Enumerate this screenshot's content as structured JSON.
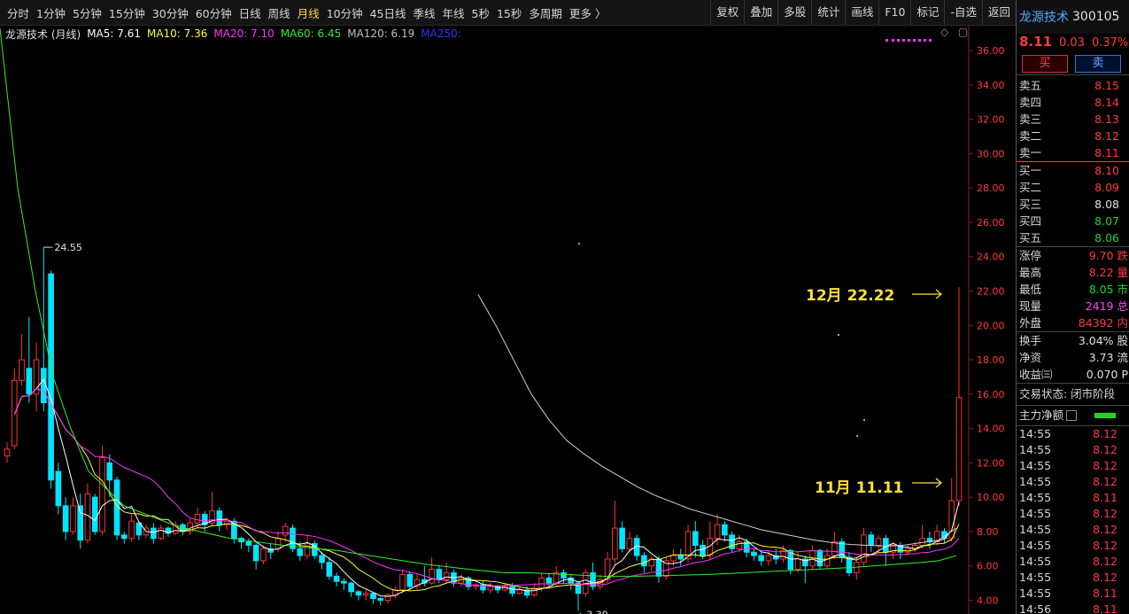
{
  "toolbar": {
    "left": [
      "分时",
      "1分钟",
      "5分钟",
      "15分钟",
      "30分钟",
      "60分钟",
      "日线",
      "周线",
      "月线",
      "10分钟",
      "45日线",
      "季线",
      "年线",
      "5秒",
      "15秒",
      "多周期",
      "更多 〉"
    ],
    "active": "月线",
    "right": [
      "复权",
      "叠加",
      "多股",
      "统计",
      "画线",
      "F10",
      "标记",
      "-自选",
      "返回"
    ]
  },
  "legend": {
    "title": "龙源技术 (月线)",
    "items": [
      {
        "text": "MA5: 7.61",
        "color": "#ffffff"
      },
      {
        "text": "MA10: 7.36",
        "color": "#ffff33"
      },
      {
        "text": "MA20: 7.10",
        "color": "#ff33ff"
      },
      {
        "text": "MA60: 6.45",
        "color": "#33ee33"
      },
      {
        "text": "MA120: 6.19",
        "color": "#c0c0c0"
      },
      {
        "text": "MA250:",
        "color": "#3333ff"
      }
    ],
    "diamond_icon": "◇",
    "window_icon": "▢"
  },
  "annotations": {
    "dec": "12月 22.22",
    "nov": "11月 11.11",
    "high_label": "24.55",
    "low_label": "3.39"
  },
  "chart_data": {
    "type": "candlestick",
    "ylim": [
      3.2,
      37.5
    ],
    "y_ticks": [
      "4.00",
      "6.00",
      "8.00",
      "10.00",
      "12.00",
      "14.00",
      "16.00",
      "18.00",
      "20.00",
      "22.00",
      "24.00",
      "26.00",
      "28.00",
      "30.00",
      "32.00",
      "34.00",
      "36.00"
    ],
    "colors": {
      "up": "#ff3333",
      "down": "#00e5ff"
    },
    "candles": [
      [
        12.4,
        12.8,
        12.0,
        13.2
      ],
      [
        13.0,
        16.8,
        12.8,
        17.5
      ],
      [
        16.8,
        18.0,
        16.5,
        19.5
      ],
      [
        17.5,
        16.0,
        15.5,
        20.5
      ],
      [
        16.0,
        18.0,
        15.0,
        19.0
      ],
      [
        17.5,
        15.5,
        15.0,
        24.55
      ],
      [
        23.0,
        11.0,
        10.5,
        23.2
      ],
      [
        11.5,
        9.5,
        9.0,
        12.0
      ],
      [
        9.5,
        8.0,
        7.5,
        10.0
      ],
      [
        8.0,
        9.5,
        7.8,
        10.0
      ],
      [
        9.5,
        7.5,
        7.0,
        10.2
      ],
      [
        7.5,
        10.2,
        7.3,
        10.8
      ],
      [
        10.0,
        8.0,
        7.8,
        10.2
      ],
      [
        8.0,
        12.3,
        7.8,
        13.0
      ],
      [
        12.0,
        11.0,
        10.0,
        12.5
      ],
      [
        11.0,
        7.8,
        7.5,
        11.2
      ],
      [
        7.8,
        7.6,
        7.3,
        8.0
      ],
      [
        7.6,
        8.6,
        7.4,
        9.0
      ],
      [
        8.5,
        7.8,
        7.5,
        8.6
      ],
      [
        7.8,
        8.2,
        7.6,
        8.4
      ],
      [
        8.2,
        7.6,
        7.3,
        8.5
      ],
      [
        7.6,
        8.2,
        7.5,
        8.4
      ],
      [
        8.2,
        7.9,
        7.7,
        8.3
      ],
      [
        7.9,
        8.4,
        7.8,
        8.6
      ],
      [
        8.4,
        8.0,
        7.8,
        8.5
      ],
      [
        8.0,
        8.5,
        7.8,
        8.8
      ],
      [
        8.5,
        9.0,
        8.2,
        9.4
      ],
      [
        9.0,
        8.4,
        8.0,
        9.2
      ],
      [
        8.5,
        9.2,
        8.3,
        10.3
      ],
      [
        9.2,
        8.4,
        8.0,
        9.4
      ],
      [
        8.4,
        8.6,
        8.1,
        8.8
      ],
      [
        8.6,
        7.6,
        7.3,
        8.8
      ],
      [
        7.6,
        7.4,
        7.0,
        7.7
      ],
      [
        7.4,
        7.2,
        6.8,
        7.6
      ],
      [
        7.2,
        6.3,
        5.8,
        7.4
      ],
      [
        6.3,
        7.0,
        6.1,
        7.2
      ],
      [
        7.0,
        6.8,
        6.4,
        7.3
      ],
      [
        7.0,
        7.6,
        6.8,
        8.0
      ],
      [
        7.8,
        8.3,
        7.4,
        8.5
      ],
      [
        8.2,
        7.0,
        6.8,
        8.4
      ],
      [
        7.0,
        6.6,
        6.3,
        7.4
      ],
      [
        6.6,
        7.3,
        6.4,
        7.8
      ],
      [
        7.3,
        6.6,
        6.4,
        7.5
      ],
      [
        6.6,
        6.2,
        5.8,
        6.8
      ],
      [
        6.2,
        5.4,
        5.2,
        6.5
      ],
      [
        5.4,
        5.1,
        4.8,
        5.6
      ],
      [
        5.1,
        5.0,
        4.6,
        5.3
      ],
      [
        5.0,
        4.5,
        4.2,
        5.1
      ],
      [
        4.5,
        4.3,
        4.0,
        4.6
      ],
      [
        4.3,
        4.4,
        4.0,
        4.6
      ],
      [
        4.4,
        4.1,
        3.8,
        4.5
      ],
      [
        4.1,
        4.0,
        3.7,
        4.2
      ],
      [
        4.0,
        4.3,
        3.8,
        4.4
      ],
      [
        4.3,
        4.6,
        4.1,
        4.8
      ],
      [
        4.6,
        5.5,
        4.4,
        5.8
      ],
      [
        5.5,
        4.8,
        4.6,
        5.7
      ],
      [
        4.8,
        5.2,
        4.6,
        5.5
      ],
      [
        5.2,
        5.0,
        4.8,
        6.0
      ],
      [
        5.0,
        5.8,
        4.9,
        6.5
      ],
      [
        5.8,
        5.2,
        5.0,
        6.0
      ],
      [
        5.2,
        5.6,
        5.0,
        6.2
      ],
      [
        5.6,
        5.0,
        4.8,
        5.8
      ],
      [
        5.0,
        5.3,
        4.8,
        5.5
      ],
      [
        5.3,
        4.8,
        4.6,
        5.4
      ],
      [
        4.8,
        4.9,
        4.6,
        5.0
      ],
      [
        4.9,
        4.6,
        4.4,
        5.1
      ],
      [
        4.6,
        4.8,
        4.4,
        5.0
      ],
      [
        4.8,
        4.6,
        4.4,
        4.9
      ],
      [
        4.6,
        4.8,
        4.5,
        5.0
      ],
      [
        4.8,
        4.4,
        4.2,
        5.0
      ],
      [
        4.4,
        4.6,
        4.3,
        4.8
      ],
      [
        4.6,
        4.3,
        4.1,
        4.8
      ],
      [
        4.3,
        4.7,
        4.2,
        5.0
      ],
      [
        4.7,
        5.3,
        4.5,
        5.6
      ],
      [
        5.3,
        5.0,
        4.8,
        5.6
      ],
      [
        5.0,
        5.6,
        4.8,
        6.0
      ],
      [
        5.6,
        5.3,
        5.0,
        5.8
      ],
      [
        5.3,
        5.0,
        4.6,
        5.5
      ],
      [
        5.0,
        4.4,
        3.39,
        5.1
      ],
      [
        4.4,
        5.6,
        4.2,
        5.8
      ],
      [
        5.6,
        4.8,
        4.6,
        6.2
      ],
      [
        4.8,
        5.2,
        4.6,
        5.5
      ],
      [
        5.2,
        6.4,
        5.0,
        6.8
      ],
      [
        6.4,
        8.2,
        6.0,
        9.8
      ],
      [
        8.2,
        7.0,
        6.8,
        8.6
      ],
      [
        7.0,
        7.6,
        6.8,
        8.0
      ],
      [
        7.6,
        6.6,
        6.3,
        7.8
      ],
      [
        6.6,
        6.0,
        5.6,
        6.8
      ],
      [
        6.0,
        6.4,
        5.7,
        6.6
      ],
      [
        6.4,
        5.4,
        5.0,
        6.6
      ],
      [
        5.4,
        6.3,
        5.2,
        6.5
      ],
      [
        6.3,
        6.6,
        6.0,
        7.0
      ],
      [
        6.6,
        6.4,
        6.0,
        7.0
      ],
      [
        6.4,
        8.0,
        6.2,
        8.4
      ],
      [
        8.0,
        7.2,
        6.5,
        8.6
      ],
      [
        7.2,
        6.6,
        6.4,
        7.5
      ],
      [
        6.6,
        7.6,
        6.4,
        8.6
      ],
      [
        7.6,
        8.4,
        7.2,
        9.0
      ],
      [
        8.4,
        7.8,
        7.4,
        8.6
      ],
      [
        7.8,
        7.0,
        6.8,
        8.0
      ],
      [
        7.0,
        7.4,
        6.8,
        7.8
      ],
      [
        7.4,
        6.8,
        6.5,
        7.6
      ],
      [
        6.8,
        6.6,
        6.3,
        7.0
      ],
      [
        6.6,
        6.3,
        6.0,
        6.8
      ],
      [
        6.3,
        6.6,
        6.0,
        6.9
      ],
      [
        6.6,
        6.4,
        6.1,
        7.0
      ],
      [
        6.4,
        6.9,
        6.2,
        7.2
      ],
      [
        6.9,
        5.8,
        5.5,
        7.0
      ],
      [
        5.8,
        6.4,
        5.6,
        6.8
      ],
      [
        6.4,
        6.0,
        5.0,
        6.6
      ],
      [
        6.0,
        6.9,
        5.8,
        7.2
      ],
      [
        6.9,
        6.0,
        5.8,
        7.0
      ],
      [
        6.0,
        6.6,
        5.8,
        7.0
      ],
      [
        6.6,
        7.4,
        6.4,
        8.0
      ],
      [
        7.4,
        6.5,
        6.2,
        7.6
      ],
      [
        6.5,
        5.6,
        5.4,
        6.8
      ],
      [
        5.6,
        6.2,
        5.2,
        6.5
      ],
      [
        6.2,
        7.8,
        6.0,
        8.2
      ],
      [
        7.8,
        7.2,
        6.8,
        8.0
      ],
      [
        7.2,
        7.6,
        6.8,
        7.8
      ],
      [
        7.6,
        6.8,
        6.0,
        7.8
      ],
      [
        6.8,
        7.2,
        6.4,
        7.4
      ],
      [
        7.2,
        6.8,
        6.4,
        7.4
      ],
      [
        6.8,
        7.0,
        6.6,
        7.2
      ],
      [
        7.0,
        7.2,
        6.8,
        7.4
      ],
      [
        7.2,
        7.6,
        7.0,
        8.4
      ],
      [
        7.6,
        7.4,
        7.0,
        8.0
      ],
      [
        7.4,
        8.0,
        7.2,
        8.4
      ],
      [
        8.0,
        7.6,
        7.3,
        8.2
      ],
      [
        7.6,
        9.8,
        7.4,
        11.11
      ],
      [
        9.8,
        15.8,
        9.5,
        22.22
      ]
    ],
    "ma": [
      {
        "name": "MA5",
        "color": "#ffffff",
        "points": []
      },
      {
        "name": "MA10",
        "color": "#ffff33",
        "points": []
      },
      {
        "name": "MA20",
        "color": "#ff33ff",
        "points": []
      },
      {
        "name": "MA60",
        "color": "#33ee33",
        "points": [
          [
            0,
            37.3
          ],
          [
            20,
            28
          ],
          [
            40,
            22
          ],
          [
            60,
            17
          ],
          [
            80,
            14
          ],
          [
            100,
            11.5
          ],
          [
            140,
            9.5
          ],
          [
            200,
            8.3
          ],
          [
            260,
            7.6
          ],
          [
            320,
            7.2
          ],
          [
            380,
            6.9
          ],
          [
            430,
            6.5
          ],
          [
            480,
            6.1
          ],
          [
            530,
            5.8
          ],
          [
            570,
            5.6
          ],
          [
            600,
            5.6
          ],
          [
            640,
            5.5
          ],
          [
            680,
            5.4
          ],
          [
            720,
            5.4
          ],
          [
            760,
            5.45
          ],
          [
            800,
            5.5
          ],
          [
            840,
            5.6
          ],
          [
            880,
            5.7
          ],
          [
            920,
            5.8
          ],
          [
            960,
            5.9
          ],
          [
            1000,
            6.05
          ],
          [
            1040,
            6.2
          ],
          [
            1060,
            6.3
          ],
          [
            1080,
            6.6
          ]
        ]
      },
      {
        "name": "MA120",
        "color": "#d0d0d0",
        "points": [
          [
            540,
            21.8
          ],
          [
            560,
            20
          ],
          [
            580,
            18
          ],
          [
            600,
            16
          ],
          [
            620,
            14.5
          ],
          [
            640,
            13.3
          ],
          [
            660,
            12.5
          ],
          [
            680,
            11.8
          ],
          [
            700,
            11.2
          ],
          [
            720,
            10.6
          ],
          [
            740,
            10.1
          ],
          [
            760,
            9.7
          ],
          [
            780,
            9.3
          ],
          [
            800,
            9.0
          ],
          [
            820,
            8.7
          ],
          [
            840,
            8.4
          ],
          [
            860,
            8.1
          ],
          [
            880,
            7.9
          ],
          [
            900,
            7.7
          ],
          [
            920,
            7.5
          ],
          [
            940,
            7.35
          ],
          [
            960,
            7.25
          ],
          [
            980,
            7.2
          ],
          [
            1000,
            7.15
          ],
          [
            1020,
            7.2
          ],
          [
            1040,
            7.35
          ],
          [
            1060,
            7.5
          ],
          [
            1080,
            8.2
          ]
        ]
      }
    ]
  },
  "panel": {
    "name": "龙源技术",
    "code": "300105",
    "price": "8.11",
    "change": "0.03",
    "pct": "0.37%",
    "buy_btn": "买",
    "sell_btn": "卖",
    "asks": [
      {
        "label": "卖五",
        "price": "8.15",
        "cls": "red"
      },
      {
        "label": "卖四",
        "price": "8.14",
        "cls": "red"
      },
      {
        "label": "卖三",
        "price": "8.13",
        "cls": "red"
      },
      {
        "label": "卖二",
        "price": "8.12",
        "cls": "red"
      },
      {
        "label": "卖一",
        "price": "8.11",
        "cls": "red"
      }
    ],
    "bids": [
      {
        "label": "买一",
        "price": "8.10",
        "cls": "red"
      },
      {
        "label": "买二",
        "price": "8.09",
        "cls": "red"
      },
      {
        "label": "买三",
        "price": "8.08",
        "cls": "white"
      },
      {
        "label": "买四",
        "price": "8.07",
        "cls": "green"
      },
      {
        "label": "买五",
        "price": "8.06",
        "cls": "green"
      }
    ],
    "stats1": [
      {
        "label": "涨停",
        "value": "9.70",
        "cls": "red",
        "extra": "跌"
      },
      {
        "label": "最高",
        "value": "8.22",
        "cls": "red",
        "extra": "量"
      },
      {
        "label": "最低",
        "value": "8.05",
        "cls": "green",
        "extra": "市"
      },
      {
        "label": "现量",
        "value": "2419",
        "cls": "mag",
        "extra": "总"
      },
      {
        "label": "外盘",
        "value": "84392",
        "cls": "red",
        "extra": "内"
      }
    ],
    "stats2": [
      {
        "label": "换手",
        "value": "3.04%",
        "cls": "white",
        "extra": "股"
      },
      {
        "label": "净资",
        "value": "3.73",
        "cls": "white",
        "extra": "流"
      },
      {
        "label": "收益㈢",
        "value": "0.070",
        "cls": "white",
        "extra": "P"
      }
    ],
    "status": "交易状态: 闭市阶段",
    "net_label": "主力净额",
    "ticks": [
      {
        "t": "14:55",
        "p": "8.12"
      },
      {
        "t": "14:55",
        "p": "8.12"
      },
      {
        "t": "14:55",
        "p": "8.12"
      },
      {
        "t": "14:55",
        "p": "8.12"
      },
      {
        "t": "14:55",
        "p": "8.11"
      },
      {
        "t": "14:55",
        "p": "8.12"
      },
      {
        "t": "14:55",
        "p": "8.12"
      },
      {
        "t": "14:55",
        "p": "8.12"
      },
      {
        "t": "14:55",
        "p": "8.12"
      },
      {
        "t": "14:55",
        "p": "8.12"
      },
      {
        "t": "14:55",
        "p": "8.11"
      },
      {
        "t": "14:56",
        "p": "8.11"
      }
    ]
  }
}
